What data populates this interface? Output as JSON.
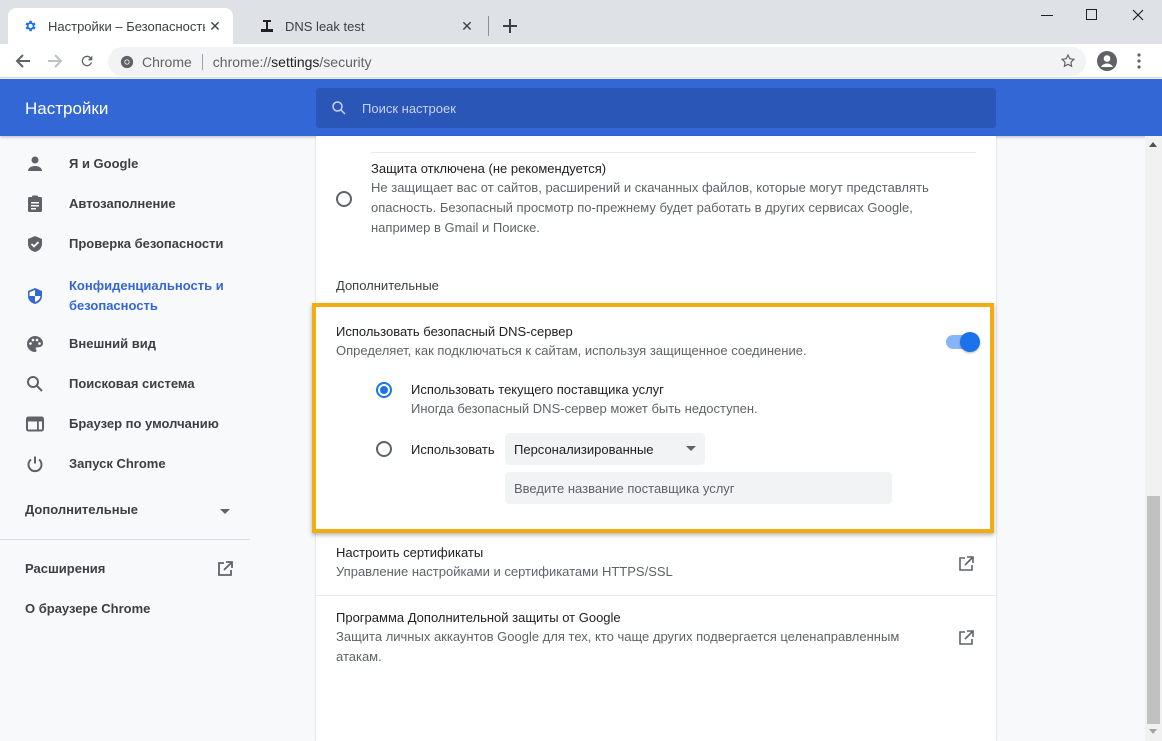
{
  "tabs": [
    {
      "title": "Настройки – Безопасность",
      "icon": "gear-icon",
      "active": true
    },
    {
      "title": "DNS leak test",
      "icon": "faucet-icon",
      "active": false
    }
  ],
  "window_controls": {
    "minimize": "minimize",
    "maximize": "maximize",
    "close": "close"
  },
  "toolbar": {
    "chip": "Chrome",
    "url_scheme": "chrome://",
    "url_host": "settings",
    "url_path": "/security"
  },
  "header": {
    "title": "Настройки",
    "search_placeholder": "Поиск настроек"
  },
  "sidebar": {
    "items": [
      {
        "label": "Я и Google",
        "icon": "person-icon"
      },
      {
        "label": "Автозаполнение",
        "icon": "clipboard-icon"
      },
      {
        "label": "Проверка безопасности",
        "icon": "shield-check-icon"
      },
      {
        "label": "Конфиденциальность и безопасность",
        "label_line1": "Конфиденциальность и",
        "label_line2": "безопасность",
        "icon": "privacy-shield-icon",
        "active": true
      },
      {
        "label": "Внешний вид",
        "icon": "palette-icon"
      },
      {
        "label": "Поисковая система",
        "icon": "search-icon"
      },
      {
        "label": "Браузер по умолчанию",
        "icon": "browser-window-icon"
      },
      {
        "label": "Запуск Chrome",
        "icon": "power-icon"
      }
    ],
    "advanced": "Дополнительные",
    "extensions": "Расширения",
    "about": "О браузере Chrome"
  },
  "main": {
    "no_protection": {
      "title": "Защита отключена (не рекомендуется)",
      "desc_line1": "Не защищает вас от сайтов, расширений и скачанных файлов, которые могут представлять",
      "desc_line2": "опасность. Безопасный просмотр по-прежнему будет работать в других сервисах Google,",
      "desc_line3": "например в Gmail и Поиске.",
      "selected": false
    },
    "advanced_title": "Дополнительные",
    "secure_dns": {
      "title": "Использовать безопасный DNS-сервер",
      "desc": "Определяет, как подключаться к сайтам, используя защищенное соединение.",
      "enabled": true,
      "option_current": {
        "title": "Использовать текущего поставщика услуг",
        "desc": "Иногда безопасный DNS-сервер может быть недоступен.",
        "selected": true
      },
      "option_custom": {
        "label": "Использовать",
        "select_value": "Персонализированные",
        "input_placeholder": "Введите название поставщика услуг",
        "input_value": "",
        "selected": false
      }
    },
    "certificates": {
      "title": "Настроить сертификаты",
      "desc": "Управление настройками и сертификатами HTTPS/SSL"
    },
    "advanced_protection": {
      "title": "Программа Дополнительной защиты от Google",
      "desc_line1": "Защита личных аккаунтов Google для тех, кто чаще других подвергается целенаправленным",
      "desc_line2": "атакам."
    }
  },
  "colors": {
    "header_blue": "#3367d6",
    "accent": "#1a73e8",
    "highlight": "#f2ad12"
  }
}
